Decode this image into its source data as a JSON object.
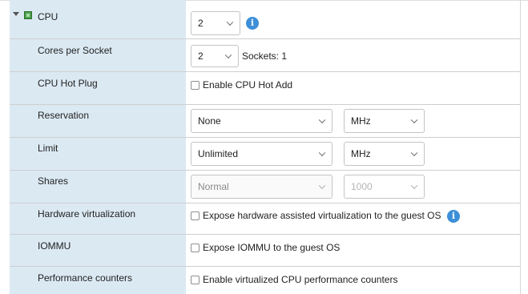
{
  "cpu": {
    "label": "CPU",
    "value": "2",
    "icon": "cpu-chip-icon",
    "info_icon": "info-icon"
  },
  "cores_per_socket": {
    "label": "Cores per Socket",
    "value": "2",
    "sockets_text": "Sockets: 1"
  },
  "cpu_hot_plug": {
    "label": "CPU Hot Plug",
    "checkbox_label": "Enable CPU Hot Add",
    "checked": false
  },
  "reservation": {
    "label": "Reservation",
    "value": "None",
    "unit": "MHz"
  },
  "limit": {
    "label": "Limit",
    "value": "Unlimited",
    "unit": "MHz"
  },
  "shares": {
    "label": "Shares",
    "value": "Normal",
    "number": "1000"
  },
  "hardware_virtualization": {
    "label": "Hardware virtualization",
    "checkbox_label": "Expose hardware assisted virtualization to the guest OS",
    "checked": false
  },
  "iommu": {
    "label": "IOMMU",
    "checkbox_label": "Expose IOMMU to the guest OS",
    "checked": false
  },
  "performance_counters": {
    "label": "Performance counters",
    "checkbox_label": "Enable virtualized CPU performance counters",
    "checked": false
  },
  "colors": {
    "label_column": "#dbe9f3",
    "info_blue": "#3d8fd8",
    "cpu_icon_green": "#4aa24a"
  }
}
